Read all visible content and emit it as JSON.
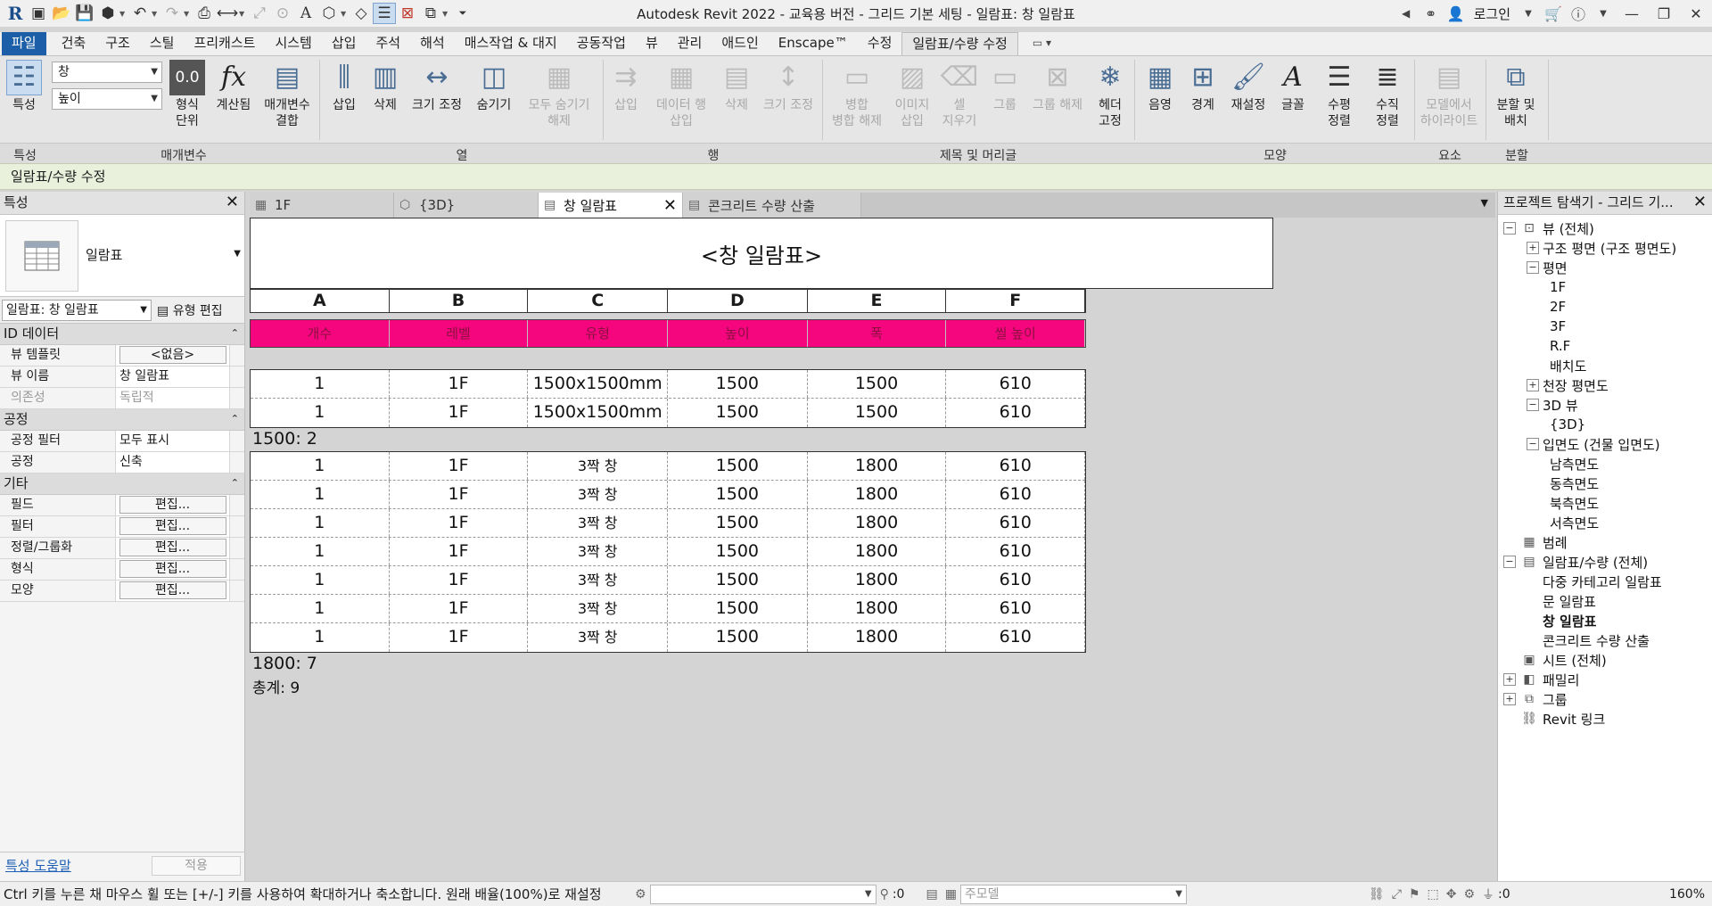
{
  "app": {
    "title": "Autodesk Revit 2022 - 교육용 버전 - 그리드 기본 세팅 - 일람표: 창 일람표",
    "logo": "R",
    "login_label": "로그인"
  },
  "menu_tabs": [
    "파일",
    "건축",
    "구조",
    "스틸",
    "프리캐스트",
    "시스템",
    "삽입",
    "주석",
    "해석",
    "매스작업 & 대지",
    "공동작업",
    "뷰",
    "관리",
    "애드인",
    "Enscape™",
    "수정",
    "일람표/수량 수정"
  ],
  "ribbon": {
    "selector_1": "창",
    "selector_2": "높이",
    "buttons": {
      "properties": "특성",
      "format_unit": "형식\n단위",
      "calculated": "계산됨",
      "combine_params": "매개변수\n결합",
      "insert_col": "삽입",
      "delete_col": "삭제",
      "resize_col": "크기 조정",
      "hide_col": "숨기기",
      "unhide_all": "모두 숨기기\n해제",
      "insert_row": "삽입",
      "insert_data_row": "데이터 행\n삽입",
      "delete_row": "삭제",
      "resize_row": "크기 조정",
      "merge_unmerge": "병합\n병합 해제",
      "insert_image": "이미지\n삽입",
      "clear_cell": "셀\n지우기",
      "group": "그룹",
      "ungroup": "그룹 해제",
      "freeze_header": "헤더\n고정",
      "shading": "음영",
      "borders": "경계",
      "reset": "재설정",
      "font": "글꼴",
      "align_h": "수평\n정렬",
      "align_v": "수직\n정렬",
      "highlight_in_model": "모델에서\n하이라이트",
      "split_place": "분할 및\n배치"
    },
    "panels": [
      "특성",
      "매개변수",
      "열",
      "행",
      "제목 및 머리글",
      "모양",
      "요소",
      "분할"
    ]
  },
  "context_bar": "일람표/수량 수정",
  "properties": {
    "title": "특성",
    "type_name": "일람표",
    "instance_selector": "일람표: 창 일람표",
    "edit_type": "유형 편집",
    "groups": [
      {
        "name": "ID 데이터",
        "rows": [
          {
            "k": "뷰 템플릿",
            "v": "<없음>",
            "btn": true
          },
          {
            "k": "뷰 이름",
            "v": "창 일람표"
          },
          {
            "k": "의존성",
            "v": "독립적",
            "dim": true
          }
        ]
      },
      {
        "name": "공정",
        "rows": [
          {
            "k": "공정 필터",
            "v": "모두 표시"
          },
          {
            "k": "공정",
            "v": "신축"
          }
        ]
      },
      {
        "name": "기타",
        "rows": [
          {
            "k": "필드",
            "v": "편집...",
            "btn": true
          },
          {
            "k": "필터",
            "v": "편집...",
            "btn": true
          },
          {
            "k": "정렬/그룹화",
            "v": "편집...",
            "btn": true
          },
          {
            "k": "형식",
            "v": "편집...",
            "btn": true
          },
          {
            "k": "모양",
            "v": "편집...",
            "btn": true
          }
        ]
      }
    ],
    "help_link": "특성 도움말",
    "apply": "적용"
  },
  "view_tabs": [
    {
      "label": "1F",
      "icon": "floor-plan-icon"
    },
    {
      "label": "{3D}",
      "icon": "3d-view-icon"
    },
    {
      "label": "창 일람표",
      "icon": "schedule-icon",
      "active": true
    },
    {
      "label": "콘크리트 수량 산출",
      "icon": "schedule-icon"
    }
  ],
  "schedule": {
    "title": "<창 일람표>",
    "letters": [
      "A",
      "B",
      "C",
      "D",
      "E",
      "F"
    ],
    "headers": [
      "개수",
      "레벨",
      "유형",
      "높이",
      "폭",
      "씰 높이"
    ],
    "groups": [
      {
        "rows": [
          [
            "1",
            "1F",
            "1500x1500mm",
            "1500",
            "1500",
            "610"
          ],
          [
            "1",
            "1F",
            "1500x1500mm",
            "1500",
            "1500",
            "610"
          ]
        ],
        "subtotal": "1500: 2"
      },
      {
        "rows": [
          [
            "1",
            "1F",
            "3짝 창",
            "1500",
            "1800",
            "610"
          ],
          [
            "1",
            "1F",
            "3짝 창",
            "1500",
            "1800",
            "610"
          ],
          [
            "1",
            "1F",
            "3짝 창",
            "1500",
            "1800",
            "610"
          ],
          [
            "1",
            "1F",
            "3짝 창",
            "1500",
            "1800",
            "610"
          ],
          [
            "1",
            "1F",
            "3짝 창",
            "1500",
            "1800",
            "610"
          ],
          [
            "1",
            "1F",
            "3짝 창",
            "1500",
            "1800",
            "610"
          ],
          [
            "1",
            "1F",
            "3짝 창",
            "1500",
            "1800",
            "610"
          ]
        ],
        "subtotal": "1800: 7"
      }
    ],
    "grand_total": "총계: 9",
    "header_color": "#f6067e"
  },
  "browser": {
    "title": "프로젝트 탐색기 - 그리드 기...",
    "nodes": [
      {
        "label": "뷰 (전체)",
        "level": 0,
        "toggle": "−",
        "icon": "views-icon"
      },
      {
        "label": "구조 평면 (구조 평면도)",
        "level": 1,
        "toggle": "+"
      },
      {
        "label": "평면",
        "level": 1,
        "toggle": "−"
      },
      {
        "label": "1F",
        "level": 2
      },
      {
        "label": "2F",
        "level": 2
      },
      {
        "label": "3F",
        "level": 2
      },
      {
        "label": "R.F",
        "level": 2
      },
      {
        "label": "배치도",
        "level": 2
      },
      {
        "label": "천장 평면도",
        "level": 1,
        "toggle": "+"
      },
      {
        "label": "3D 뷰",
        "level": 1,
        "toggle": "−"
      },
      {
        "label": "{3D}",
        "level": 2
      },
      {
        "label": "입면도 (건물 입면도)",
        "level": 1,
        "toggle": "−"
      },
      {
        "label": "남측면도",
        "level": 2
      },
      {
        "label": "동측면도",
        "level": 2
      },
      {
        "label": "북측면도",
        "level": 2
      },
      {
        "label": "서측면도",
        "level": 2
      },
      {
        "label": "범례",
        "level": 0,
        "icon": "legend-icon"
      },
      {
        "label": "일람표/수량 (전체)",
        "level": 0,
        "toggle": "−",
        "icon": "schedule-icon"
      },
      {
        "label": "다중 카테고리 일람표",
        "level": 1
      },
      {
        "label": "문 일람표",
        "level": 1
      },
      {
        "label": "창 일람표",
        "level": 1,
        "bold": true
      },
      {
        "label": "콘크리트 수량 산출",
        "level": 1
      },
      {
        "label": "시트 (전체)",
        "level": 0,
        "icon": "sheet-icon"
      },
      {
        "label": "패밀리",
        "level": 0,
        "toggle": "+",
        "icon": "family-icon"
      },
      {
        "label": "그룹",
        "level": 0,
        "toggle": "+",
        "icon": "group-icon"
      },
      {
        "label": "Revit 링크",
        "level": 0,
        "icon": "link-icon"
      }
    ]
  },
  "status": {
    "message": "Ctrl 키를 누른 채 마우스 휠 또는 [+/-] 키를 사용하여 확대하거나 축소합니다. 원래 배율(100%)로 재설정",
    "count_1": ":0",
    "model_select": "주모델",
    "count_2": ":0",
    "zoom": "160%"
  }
}
